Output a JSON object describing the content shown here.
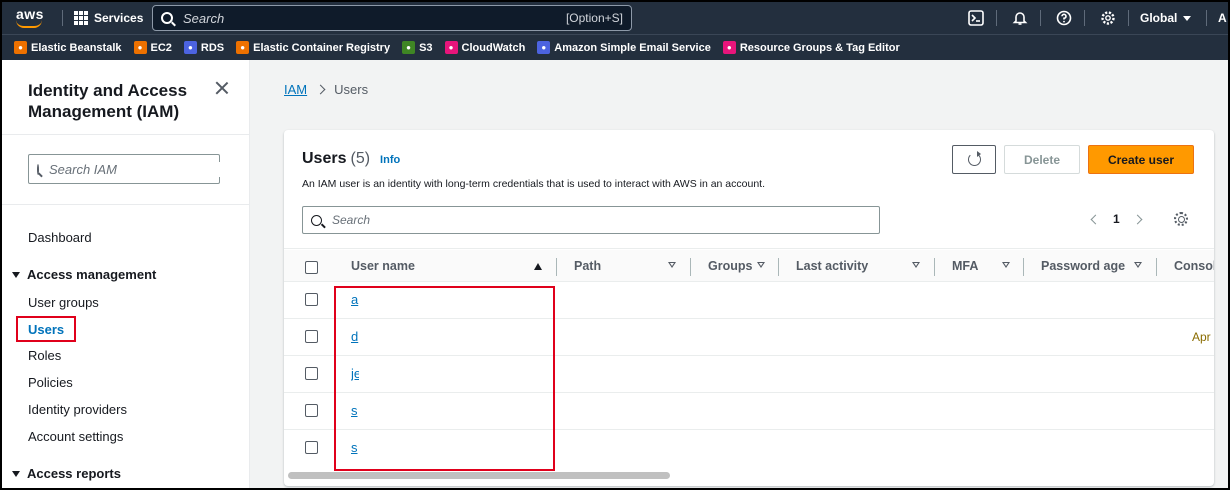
{
  "topnav": {
    "logo_text": "aws",
    "services_label": "Services",
    "search_placeholder": "Search",
    "search_shortcut": "[Option+S]",
    "region": "Global",
    "account_initial": "A",
    "icons": [
      "cloudshell-icon",
      "notifications-bell-icon",
      "help-icon",
      "settings-gear-icon"
    ]
  },
  "favorites": [
    {
      "label": "Elastic Beanstalk",
      "color": "#ed7100"
    },
    {
      "label": "EC2",
      "color": "#ed7100"
    },
    {
      "label": "RDS",
      "color": "#4c63e0"
    },
    {
      "label": "Elastic Container Registry",
      "color": "#ed7100"
    },
    {
      "label": "S3",
      "color": "#3f8624"
    },
    {
      "label": "CloudWatch",
      "color": "#e7157b"
    },
    {
      "label": "Amazon Simple Email Service",
      "color": "#4c63e0"
    },
    {
      "label": "Resource Groups & Tag Editor",
      "color": "#e7157b"
    }
  ],
  "sidebar": {
    "title": "Identity and Access Management (IAM)",
    "search_placeholder": "Search IAM",
    "dashboard": "Dashboard",
    "section_access_management": "Access management",
    "items": [
      "User groups",
      "Users",
      "Roles",
      "Policies",
      "Identity providers",
      "Account settings"
    ],
    "section_access_reports": "Access reports",
    "active_item": "Users"
  },
  "breadcrumb": {
    "root": "IAM",
    "current": "Users"
  },
  "panel": {
    "title": "Users",
    "count": "(5)",
    "info": "Info",
    "description": "An IAM user is an identity with long-term credentials that is used to interact with AWS in an account.",
    "delete_label": "Delete",
    "create_label": "Create user",
    "search_placeholder": "Search",
    "page": "1"
  },
  "table": {
    "columns": [
      "User name",
      "Path",
      "Groups",
      "Last activity",
      "MFA",
      "Password age",
      "Console"
    ],
    "rows": [
      {
        "user_name": "a",
        "extra": ""
      },
      {
        "user_name": "d",
        "extra": "Apr"
      },
      {
        "user_name": "je",
        "extra": ""
      },
      {
        "user_name": "s",
        "extra": ""
      },
      {
        "user_name": "s",
        "extra": ""
      }
    ]
  },
  "colors": {
    "nav_bg": "#232f3e",
    "primary_button": "#ff9900",
    "link": "#0073bb",
    "highlight_box": "#e0001b"
  }
}
